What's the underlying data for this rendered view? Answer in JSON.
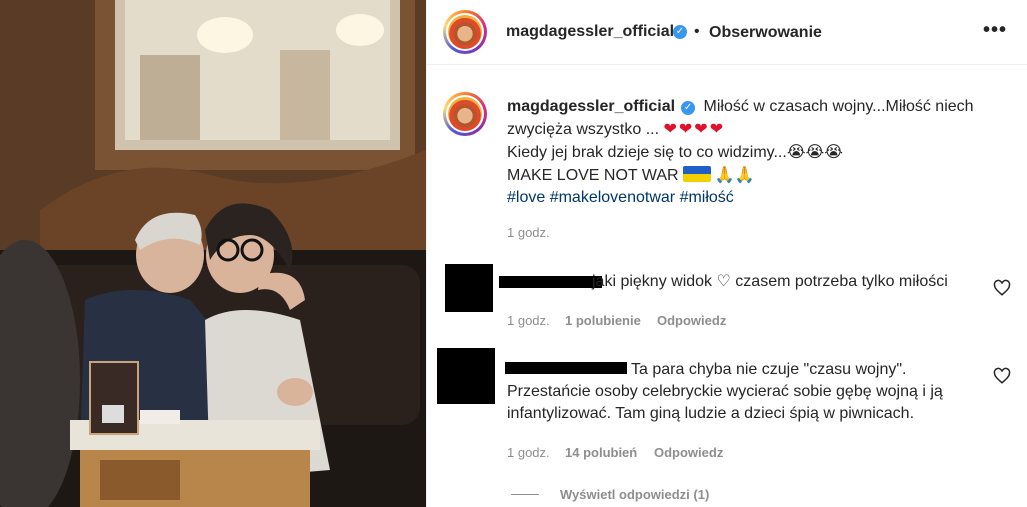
{
  "header": {
    "username": "magdagessler_official",
    "separator": "•",
    "follow_label": "Obserwowanie",
    "more_icon": "•••"
  },
  "caption": {
    "username": "magdagessler_official",
    "line1": "Miłość w czasach wojny...Miłość niech",
    "line2": "zwycięża wszystko ...",
    "hearts": "❤❤❤❤",
    "line3": "Kiedy jej brak dzieje się to co widzimy...",
    "crying": "😭😭😭",
    "line4": "MAKE LOVE NOT WAR",
    "praying": "🙏🙏",
    "tags": [
      "#love",
      "#makelovenotwar",
      "#miłość"
    ],
    "time": "1 godz."
  },
  "comments": [
    {
      "text_partial": "jaki piękny widok ♡ czasem potrzeba tylko miłości",
      "time": "1 godz.",
      "likes": "1 polubienie",
      "reply": "Odpowiedz"
    },
    {
      "line1": "Ta para chyba nie czuje \"czasu wojny\".",
      "line2": "Przestańcie osoby celebryckie wycierać sobie gębę wojną i ją",
      "line3": "infantylizować. Tam giną ludzie a dzieci śpią w piwnicach.",
      "time": "1 godz.",
      "likes": "14 polubień",
      "reply": "Odpowiedz",
      "view_replies": "Wyświetl odpowiedzi (1)"
    }
  ],
  "colors": {
    "text": "#262626",
    "muted": "#8e8e8e",
    "link": "#00376b",
    "verified": "#3897f0",
    "heart": "#e0112b"
  }
}
